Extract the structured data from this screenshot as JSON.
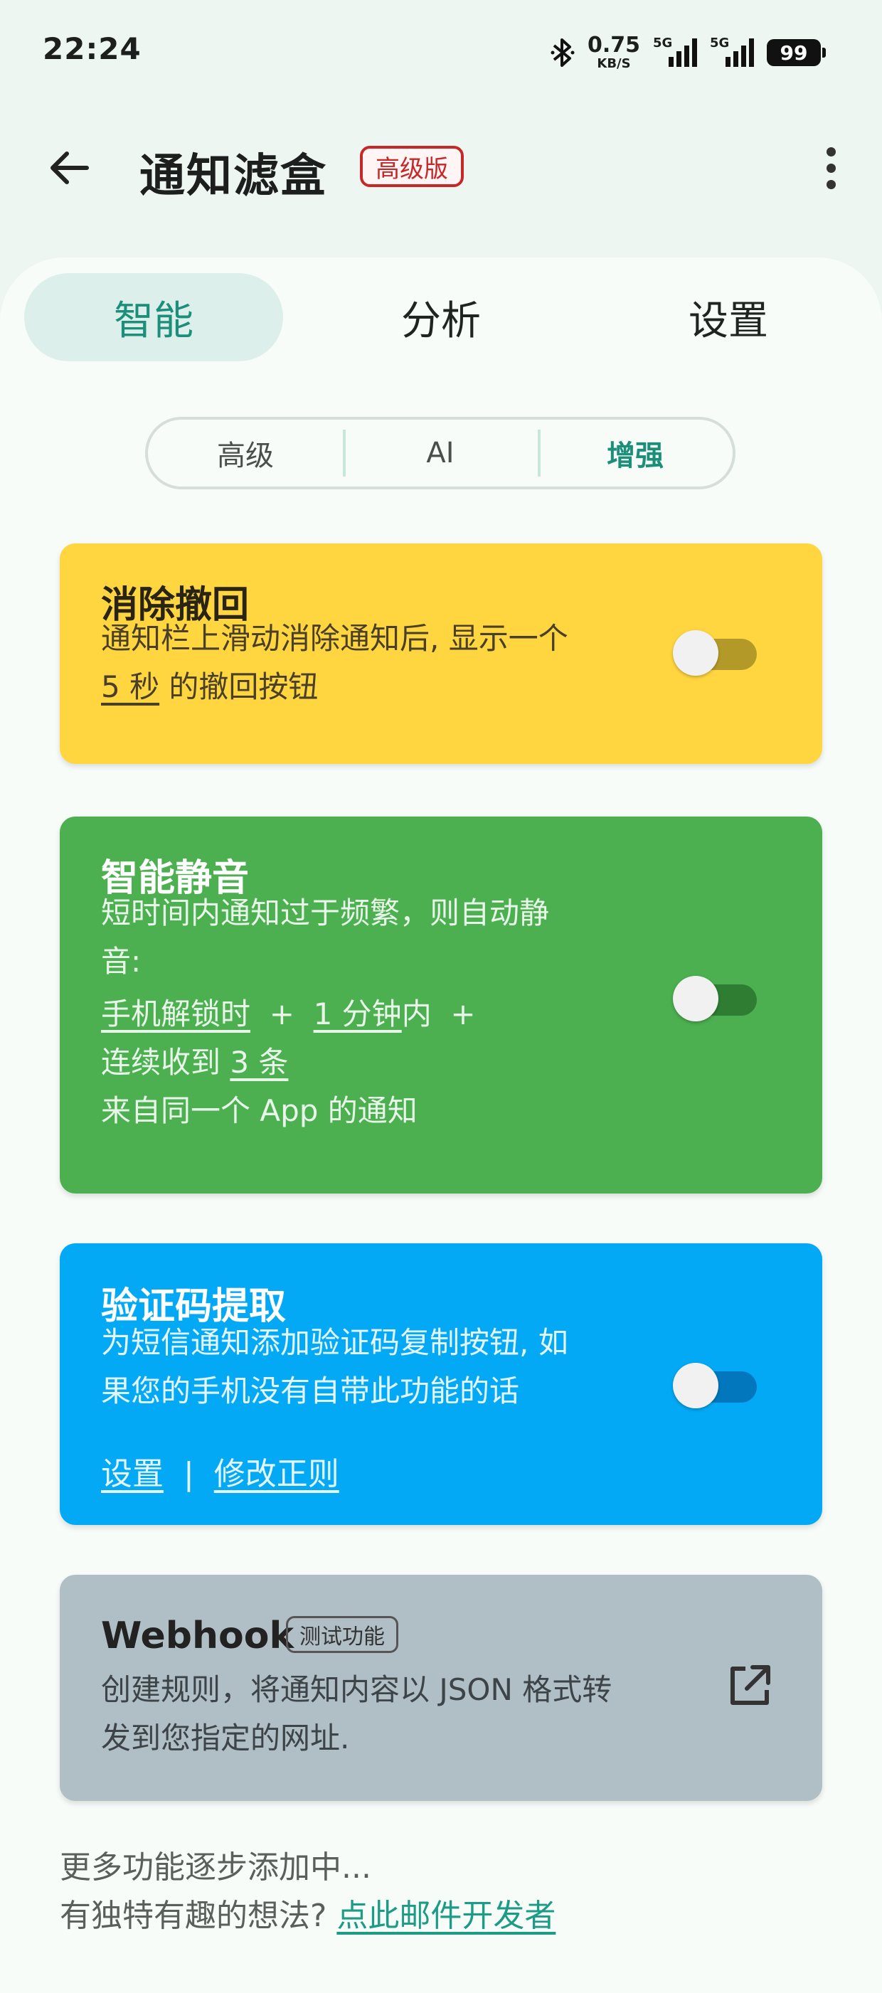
{
  "status_bar": {
    "time": "22:24",
    "bluetooth_icon": "bluetooth-icon",
    "net_speed_value": "0.75",
    "net_speed_unit": "KB/S",
    "signal1_label": "5G",
    "signal2_label": "5G",
    "battery": "99"
  },
  "app_bar": {
    "title": "通知滤盒",
    "badge": "高级版",
    "back_icon": "arrow-left-icon",
    "more_icon": "more-vertical-icon"
  },
  "tabs": [
    {
      "label": "智能",
      "active": true
    },
    {
      "label": "分析",
      "active": false
    },
    {
      "label": "设置",
      "active": false
    }
  ],
  "segments": [
    {
      "label": "高级",
      "active": false
    },
    {
      "label": "AI",
      "active": false
    },
    {
      "label": "增强",
      "active": true
    }
  ],
  "cards": {
    "dismiss_undo": {
      "title": "消除撤回",
      "desc_line1": "通知栏上滑动消除通知后, 显示一个",
      "link_seconds": "5 秒",
      "desc_line2_rest": " 的撤回按钮",
      "enabled": false,
      "color": "#FFD540"
    },
    "smart_mute": {
      "title": "智能静音",
      "desc_line1": "短时间内通知过于频繁，则自动静",
      "desc_line2": "音:",
      "link_unlock": "手机解锁时",
      "plus1": "  +  ",
      "link_minutes": "1 分钟",
      "inside": "内  +",
      "received_prefix": "连续收到 ",
      "link_count": "3 条",
      "desc_last": "来自同一个 App 的通知",
      "enabled": false,
      "color": "#4CAF50"
    },
    "code_extract": {
      "title": "验证码提取",
      "desc_line1": "为短信通知添加验证码复制按钮, 如",
      "desc_line2": "果您的手机没有自带此功能的话",
      "link_settings": "设置",
      "separator": "  |  ",
      "link_edit_regex": "修改正则",
      "enabled": false,
      "color": "#03A9F4"
    },
    "webhook": {
      "title": "Webhook",
      "badge": "测试功能",
      "desc_line1": "创建规则，将通知内容以 JSON 格式转",
      "desc_line2": "发到您指定的网址.",
      "icon": "open-external-icon",
      "color": "#B0BEC5"
    }
  },
  "footer": {
    "line1": "更多功能逐步添加中...",
    "line2_prefix": "有独特有趣的想法? ",
    "mail_link": "点此邮件开发者"
  }
}
